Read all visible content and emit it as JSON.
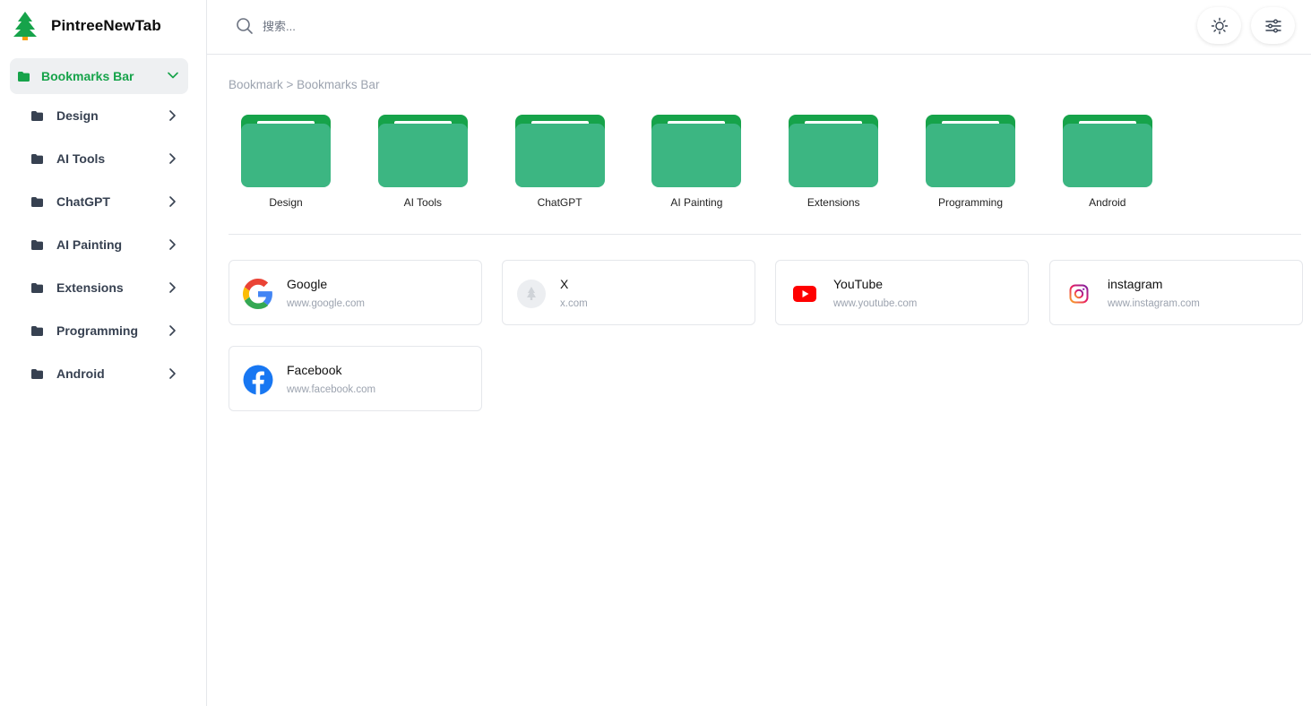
{
  "brand": {
    "name": "PintreeNewTab"
  },
  "colors": {
    "accent": "#16a34a",
    "folder": "#3cb682",
    "folder_tab": "#16a34a"
  },
  "sidebar": {
    "active": {
      "label": "Bookmarks Bar",
      "icon": "folder-icon",
      "expanded": true
    },
    "items": [
      {
        "label": "Design"
      },
      {
        "label": "AI Tools"
      },
      {
        "label": "ChatGPT"
      },
      {
        "label": "AI Painting"
      },
      {
        "label": "Extensions"
      },
      {
        "label": "Programming"
      },
      {
        "label": "Android"
      }
    ]
  },
  "header": {
    "search_placeholder": "搜索...",
    "theme_button_icon": "sun-icon",
    "settings_button_icon": "sliders-icon"
  },
  "main": {
    "breadcrumb": "Bookmark > Bookmarks Bar",
    "folders": [
      {
        "name": "Design"
      },
      {
        "name": "AI Tools"
      },
      {
        "name": "ChatGPT"
      },
      {
        "name": "AI Painting"
      },
      {
        "name": "Extensions"
      },
      {
        "name": "Programming"
      },
      {
        "name": "Android"
      }
    ],
    "bookmarks": [
      {
        "title": "Google",
        "url": "www.google.com",
        "icon": "google-icon"
      },
      {
        "title": "X",
        "url": "x.com",
        "icon": "placeholder-tree-icon"
      },
      {
        "title": "YouTube",
        "url": "www.youtube.com",
        "icon": "youtube-icon"
      },
      {
        "title": "instagram",
        "url": "www.instagram.com",
        "icon": "instagram-icon"
      },
      {
        "title": "Facebook",
        "url": "www.facebook.com",
        "icon": "facebook-icon"
      }
    ]
  }
}
